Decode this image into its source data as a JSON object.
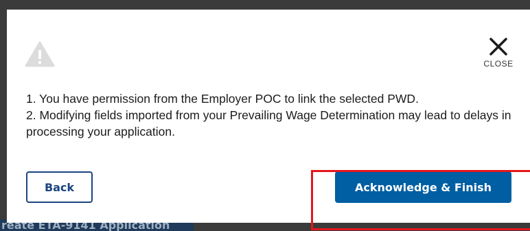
{
  "background": {
    "partial_heading": "reate ETA-9141 Application"
  },
  "modal": {
    "icon": "warning-triangle-icon",
    "close": {
      "icon": "close-icon",
      "label": "CLOSE"
    },
    "messages": [
      "1. You have permission from the Employer POC to link the selected PWD.",
      "2. Modifying fields imported from your Prevailing Wage Determination may lead to delays in processing your application."
    ],
    "buttons": {
      "back_label": "Back",
      "primary_label": "Acknowledge & Finish"
    }
  },
  "colors": {
    "primary": "#005ea2",
    "outline": "#1a4480",
    "highlight": "#e4161b",
    "overlay": "#3b3b3b"
  }
}
